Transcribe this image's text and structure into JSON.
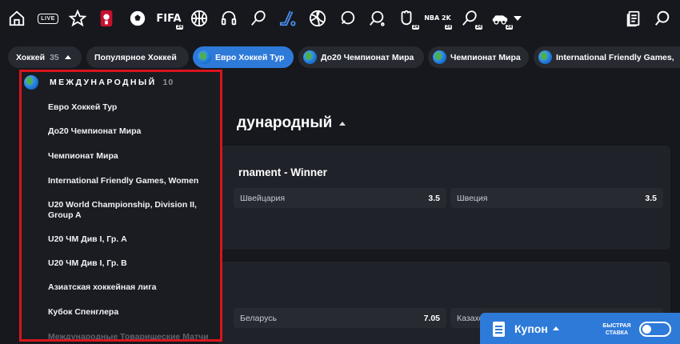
{
  "topbar": {
    "icons": [
      {
        "name": "home-icon"
      },
      {
        "name": "live-icon",
        "label": "LIVE"
      },
      {
        "name": "star-favorites-icon"
      },
      {
        "name": "world-cup-icon"
      },
      {
        "name": "football-icon"
      },
      {
        "name": "fifa-icon",
        "label": "FIFA",
        "badge": "24"
      },
      {
        "name": "basketball-icon"
      },
      {
        "name": "esports-headset-icon"
      },
      {
        "name": "tennis-icon"
      },
      {
        "name": "hockey-icon",
        "active": true
      },
      {
        "name": "volleyball-icon"
      },
      {
        "name": "handball-icon"
      },
      {
        "name": "table-tennis-icon"
      },
      {
        "name": "fighting-icon",
        "badge": "24"
      },
      {
        "name": "nba2k-icon",
        "label": "NBA 2K",
        "badge": "24"
      },
      {
        "name": "tennis-24-icon",
        "badge": "24"
      },
      {
        "name": "motorsport-24-icon",
        "badge": "24"
      },
      {
        "name": "more-sports-chevron-icon"
      }
    ],
    "right_icons": [
      "betslip-document-icon",
      "search-icon"
    ]
  },
  "pills": {
    "sport": {
      "label": "Хоккей",
      "count": "35"
    },
    "items": [
      {
        "label": "Популярное Хоккей",
        "globe": false,
        "selected": false
      },
      {
        "label": "Евро Хоккей Тур",
        "globe": true,
        "selected": true
      },
      {
        "label": "До20 Чемпионат Мира",
        "globe": true,
        "selected": false
      },
      {
        "label": "Чемпионат Мира",
        "globe": true,
        "selected": false
      },
      {
        "label": "International Friendly Games,",
        "globe": true,
        "selected": false
      }
    ]
  },
  "dropdown": {
    "header": {
      "label": "МЕЖДУНАРОДНЫЙ",
      "count": "10"
    },
    "items": [
      "Евро Хоккей Тур",
      "До20 Чемпионат Мира",
      "Чемпионат Мира",
      "International Friendly Games, Women",
      "U20 World Championship, Division II, Group A",
      "U20 ЧМ Див I, Гр. А",
      "U20 ЧМ Див I, Гр. В",
      "Азиатская хоккейная лига",
      "Кубок Спенглера",
      "Международные Товарищеские Матчи"
    ]
  },
  "main": {
    "section_title": "дународный",
    "card1": {
      "title": "rnament - Winner",
      "odds": [
        {
          "team": "Швейцария",
          "value": "3.5"
        },
        {
          "team": "Швеция",
          "value": "3.5"
        }
      ]
    },
    "card2": {
      "odds": [
        {
          "team": "Беларусь",
          "value": "7.05"
        },
        {
          "team": "Казахс",
          "value": ""
        }
      ]
    }
  },
  "coupon": {
    "label": "Купон",
    "quick_bet": "БЫСТРАЯ СТАВКА",
    "quick_bet_on": false
  },
  "colors": {
    "accent": "#2e7ad9",
    "highlight_border": "#d9141c",
    "background": "#16181d"
  }
}
